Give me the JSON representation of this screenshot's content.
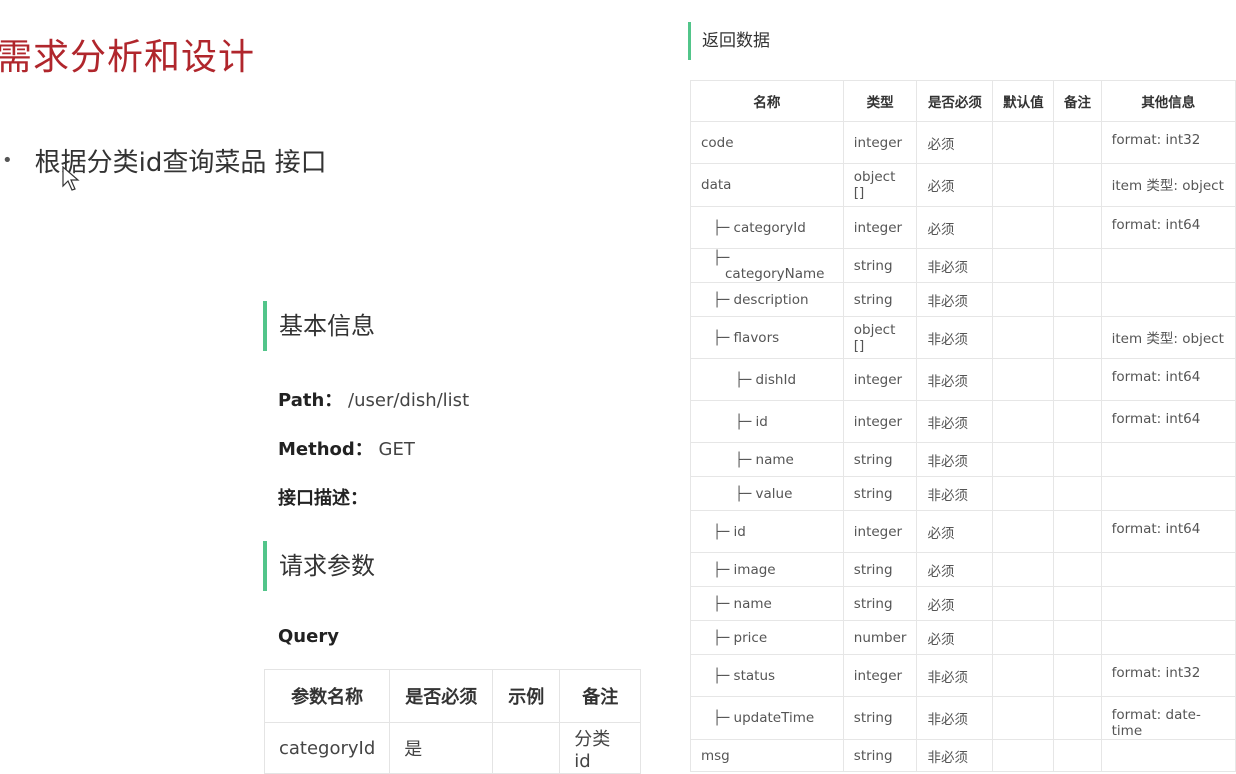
{
  "slide": {
    "title": "需求分析和设计",
    "bullet": "根据分类id查询菜品 接口"
  },
  "basic": {
    "heading": "基本信息",
    "path_label": "Path：",
    "path_value": "/user/dish/list",
    "method_label": "Method：",
    "method_value": "GET",
    "desc_label": "接口描述："
  },
  "request": {
    "heading": "请求参数",
    "query_label": "Query",
    "columns": [
      "参数名称",
      "是否必须",
      "示例",
      "备注"
    ],
    "rows": [
      [
        "categoryId",
        "是",
        "",
        "分类id"
      ]
    ]
  },
  "response": {
    "heading": "返回数据",
    "columns": [
      "名称",
      "类型",
      "是否必须",
      "默认值",
      "备注",
      "其他信息"
    ],
    "rows": [
      {
        "name": "code",
        "prefix": "",
        "type": "integer",
        "required": "必须",
        "default": "",
        "note": "",
        "other": "format: int32"
      },
      {
        "name": "data",
        "prefix": "",
        "type": "object []",
        "required": "必须",
        "default": "",
        "note": "",
        "other": "item 类型: object"
      },
      {
        "name": "categoryId",
        "prefix": "├─ ",
        "type": "integer",
        "required": "必须",
        "default": "",
        "note": "",
        "other": "format: int64"
      },
      {
        "name": "categoryName",
        "prefix": "├─ ",
        "type": "string",
        "required": "非必须",
        "default": "",
        "note": "",
        "other": ""
      },
      {
        "name": "description",
        "prefix": "├─ ",
        "type": "string",
        "required": "非必须",
        "default": "",
        "note": "",
        "other": ""
      },
      {
        "name": "flavors",
        "prefix": "├─ ",
        "type": "object []",
        "required": "非必须",
        "default": "",
        "note": "",
        "other": "item 类型: object"
      },
      {
        "name": "dishId",
        "prefix": "├─ ",
        "type": "integer",
        "required": "非必须",
        "default": "",
        "note": "",
        "other": "format: int64"
      },
      {
        "name": "id",
        "prefix": "├─ ",
        "type": "integer",
        "required": "非必须",
        "default": "",
        "note": "",
        "other": "format: int64"
      },
      {
        "name": "name",
        "prefix": "├─ ",
        "type": "string",
        "required": "非必须",
        "default": "",
        "note": "",
        "other": ""
      },
      {
        "name": "value",
        "prefix": "├─ ",
        "type": "string",
        "required": "非必须",
        "default": "",
        "note": "",
        "other": ""
      },
      {
        "name": "id",
        "prefix": "├─ ",
        "type": "integer",
        "required": "必须",
        "default": "",
        "note": "",
        "other": "format: int64"
      },
      {
        "name": "image",
        "prefix": "├─ ",
        "type": "string",
        "required": "必须",
        "default": "",
        "note": "",
        "other": ""
      },
      {
        "name": "name",
        "prefix": "├─ ",
        "type": "string",
        "required": "必须",
        "default": "",
        "note": "",
        "other": ""
      },
      {
        "name": "price",
        "prefix": "├─ ",
        "type": "number",
        "required": "必须",
        "default": "",
        "note": "",
        "other": ""
      },
      {
        "name": "status",
        "prefix": "├─ ",
        "type": "integer",
        "required": "非必须",
        "default": "",
        "note": "",
        "other": "format: int32"
      },
      {
        "name": "updateTime",
        "prefix": "├─ ",
        "type": "string",
        "required": "非必须",
        "default": "",
        "note": "",
        "other": "format: date-time"
      },
      {
        "name": "msg",
        "prefix": "",
        "type": "string",
        "required": "非必须",
        "default": "",
        "note": "",
        "other": ""
      }
    ]
  },
  "colors": {
    "title": "#b0262c",
    "accent_bar": "#52c58a",
    "border": "#e6e6e6"
  },
  "icons": [
    "cursor-arrow-icon"
  ]
}
